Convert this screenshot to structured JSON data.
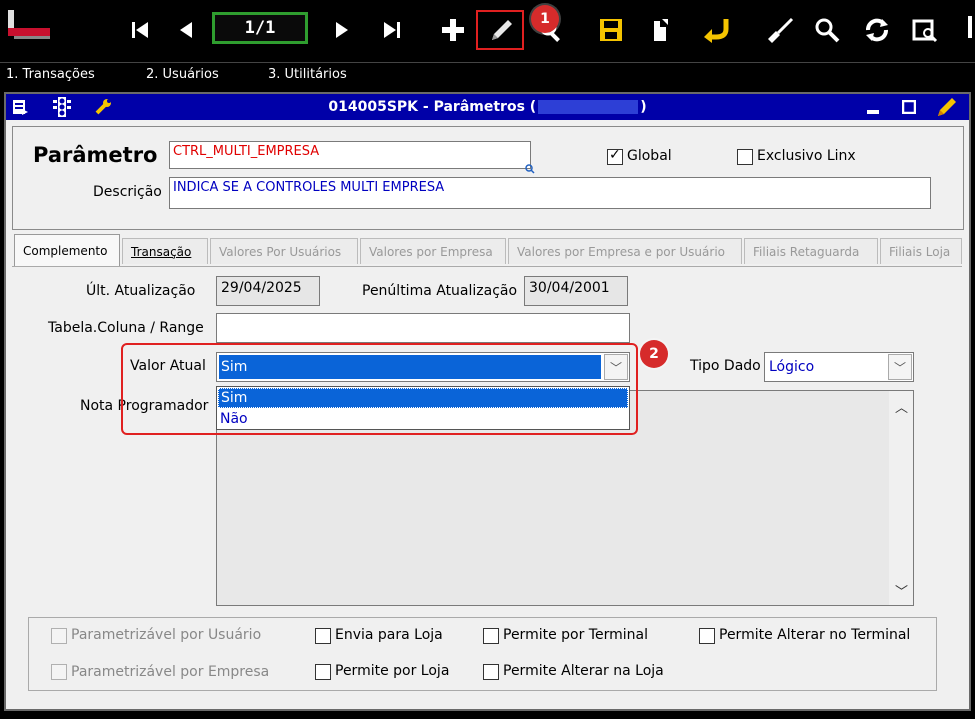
{
  "toolbar": {
    "pager": "1/1",
    "badge_1": "1",
    "icons": [
      "logo-icon",
      "first-record-icon",
      "previous-record-icon",
      "next-record-icon",
      "last-record-icon",
      "add-icon",
      "edit-icon",
      "search-icon",
      "save-icon",
      "copy-icon",
      "undo-icon",
      "clear-icon",
      "find-icon",
      "refresh-icon",
      "report-icon"
    ]
  },
  "menu": {
    "items": [
      "1. Transações",
      "2. Usuários",
      "3. Utilitários"
    ]
  },
  "window": {
    "title_prefix": "014005SPK - Parâmetros (",
    "title_suffix": ")",
    "buttons": [
      "minimize",
      "maximize",
      "edit"
    ]
  },
  "header": {
    "parametro_label": "Parâmetro",
    "parametro_value": "CTRL_MULTI_EMPRESA",
    "global_label": "Global",
    "global_checked": true,
    "exclusivo_label": "Exclusivo Linx",
    "exclusivo_checked": false,
    "descricao_label": "Descrição",
    "descricao_value": "INDICA SE A CONTROLES MULTI EMPRESA"
  },
  "tabs": [
    "Complemento",
    "Transação",
    "Valores Por Usuários",
    "Valores por Empresa",
    "Valores por Empresa e por Usuário",
    "Filiais Retaguarda",
    "Filiais Loja"
  ],
  "complemento": {
    "ult_atualizacao_label": "Últ. Atualização",
    "ult_atualizacao_value": "29/04/2025",
    "penultima_label": "Penúltima Atualização",
    "penultima_value": "30/04/2001",
    "tabela_label": "Tabela.Coluna / Range",
    "tabela_value": "",
    "valor_atual_label": "Valor Atual",
    "valor_atual_value": "Sim",
    "valor_atual_options": [
      "Sim",
      "Não"
    ],
    "badge_2": "2",
    "tipo_dado_label": "Tipo Dado",
    "tipo_dado_value": "Lógico",
    "nota_label": "Nota Programador"
  },
  "flags": {
    "parametrizavel_usuario": "Parametrizável por Usuário",
    "parametrizavel_empresa": "Parametrizável por Empresa",
    "envia_loja": "Envia para Loja",
    "permite_loja": "Permite por Loja",
    "permite_terminal": "Permite por Terminal",
    "permite_alterar_loja": "Permite Alterar na Loja",
    "permite_alterar_terminal": "Permite Alterar no Terminal"
  },
  "colors": {
    "title_bar": "#0000a8",
    "highlight": "#e02020",
    "selection": "#0a64d8",
    "pager_border": "#2f9e2f"
  }
}
